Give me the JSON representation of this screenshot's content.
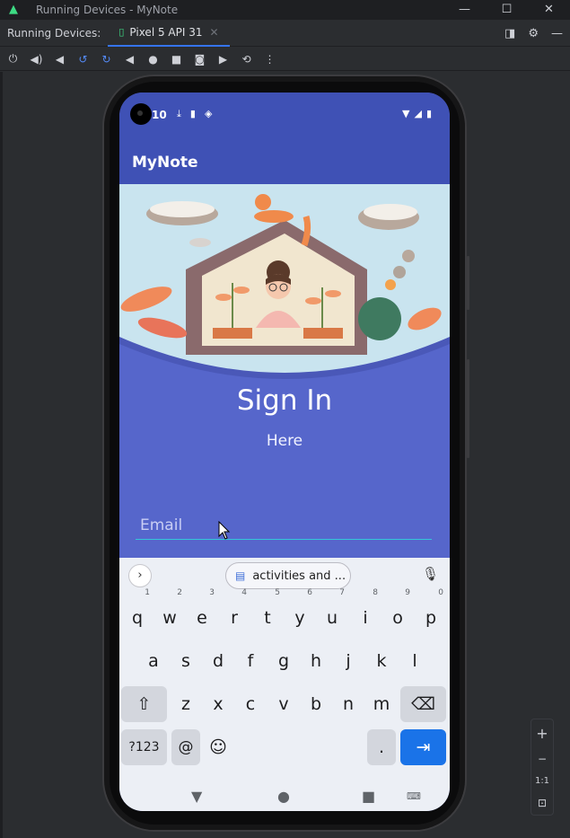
{
  "window": {
    "title": "Running Devices - MyNote",
    "controls": [
      "—",
      "☐",
      "✕"
    ]
  },
  "tabbar": {
    "label": "Running Devices:",
    "tab_label": "Pixel 5 API 31"
  },
  "device": {
    "status_time": "10",
    "app_title": "MyNote",
    "heading": "Sign In",
    "subheading": "Here",
    "email_placeholder": "Email",
    "accent": "#3f51b5",
    "background": "#5666cb"
  },
  "keyboard": {
    "suggestion": "activities and ...",
    "row1": [
      {
        "k": "q",
        "n": "1"
      },
      {
        "k": "w",
        "n": "2"
      },
      {
        "k": "e",
        "n": "3"
      },
      {
        "k": "r",
        "n": "4"
      },
      {
        "k": "t",
        "n": "5"
      },
      {
        "k": "y",
        "n": "6"
      },
      {
        "k": "u",
        "n": "7"
      },
      {
        "k": "i",
        "n": "8"
      },
      {
        "k": "o",
        "n": "9"
      },
      {
        "k": "p",
        "n": "0"
      }
    ],
    "row2": [
      "a",
      "s",
      "d",
      "f",
      "g",
      "h",
      "j",
      "k",
      "l"
    ],
    "row3": [
      "z",
      "x",
      "c",
      "v",
      "b",
      "n",
      "m"
    ],
    "symbols_label": "?123",
    "at_label": "@",
    "period_label": "."
  },
  "zoom": {
    "plus": "+",
    "minus": "−",
    "one_to_one": "1:1"
  }
}
